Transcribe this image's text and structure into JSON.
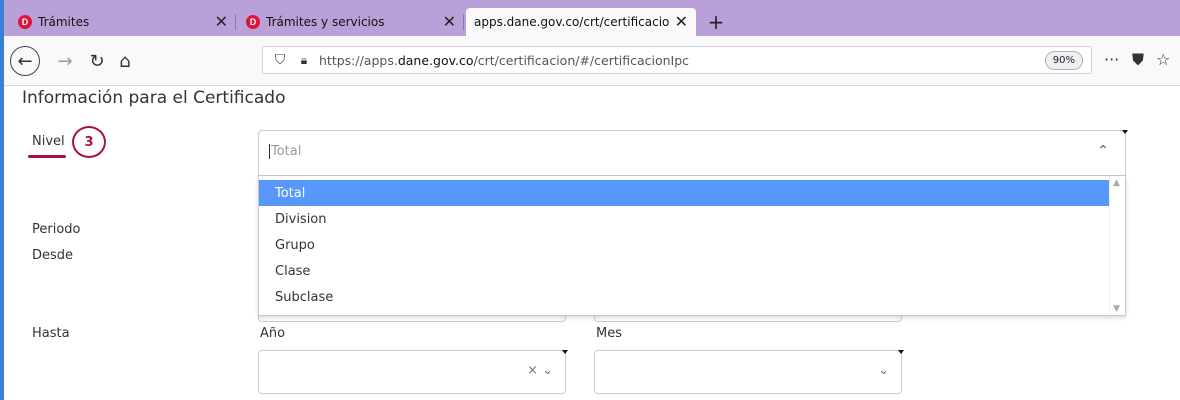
{
  "browser": {
    "tabs": [
      {
        "label": "Trámites",
        "icon": "dane-logo-icon",
        "close": "✕"
      },
      {
        "label": "Trámites y servicios",
        "icon": "dane-logo-icon",
        "close": "✕"
      },
      {
        "label": "apps.dane.gov.co/crt/certificacion",
        "icon": "",
        "close": "✕"
      }
    ],
    "new_tab": "+",
    "url_prefix": "https://apps.",
    "url_domain": "dane.gov.co",
    "url_suffix": "/crt/certificacion/#/certificacionIpc",
    "zoom": "90%",
    "menu_dots": "···",
    "accent": "#3c7fd6",
    "tabstrip_color": "#b9a0d9"
  },
  "page": {
    "heading": "Información para el Certificado",
    "nivel_label": "Nivel",
    "step_badge": "3",
    "periodo_label": "Periodo",
    "desde_label": "Desde",
    "hasta_label": "Hasta",
    "ano_label": "Año",
    "mes_label": "Mes"
  },
  "nivel_select": {
    "placeholder": "Total",
    "options": [
      "Total",
      "Division",
      "Grupo",
      "Clase",
      "Subclase"
    ],
    "selected_index": 0,
    "highlight_color": "#5897fb"
  },
  "hasta_ano_select": {
    "value": "",
    "clear": "×",
    "arrow": "⌄"
  },
  "hasta_mes_select": {
    "value": "",
    "arrow": "⌄"
  },
  "colors": {
    "badge": "#a9123e"
  }
}
